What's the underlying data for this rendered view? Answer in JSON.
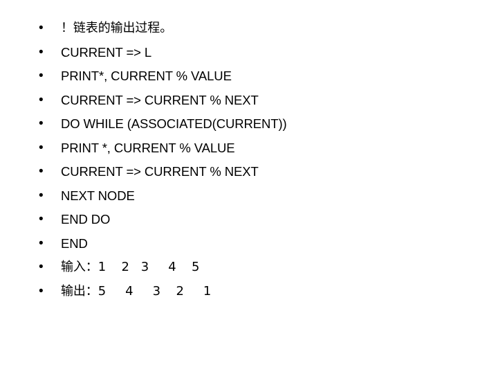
{
  "slide": {
    "background_color": "#ffffff",
    "text_color": "#000000",
    "bullet_glyph": "•"
  },
  "content": {
    "bullets": [
      {
        "text": "！链表的输出过程。",
        "script": "cjk"
      },
      {
        "text": "CURRENT => L",
        "script": "latin"
      },
      {
        "text": "PRINT*, CURRENT % VALUE",
        "script": "latin"
      },
      {
        "text": "CURRENT => CURRENT % NEXT",
        "script": "latin"
      },
      {
        "text": "DO WHILE (ASSOCIATED(CURRENT))",
        "script": "latin"
      },
      {
        "text": "PRINT *, CURRENT % VALUE",
        "script": "latin"
      },
      {
        "text": "CURRENT => CURRENT % NEXT",
        "script": "latin"
      },
      {
        "text": "NEXT NODE",
        "script": "latin"
      },
      {
        "text": "END DO",
        "script": "latin"
      },
      {
        "text": "END",
        "script": "latin"
      },
      {
        "text": "输入：1    2   3     4    5",
        "script": "cjk"
      },
      {
        "text": "输出：5     4     3    2     1",
        "script": "cjk"
      }
    ]
  }
}
